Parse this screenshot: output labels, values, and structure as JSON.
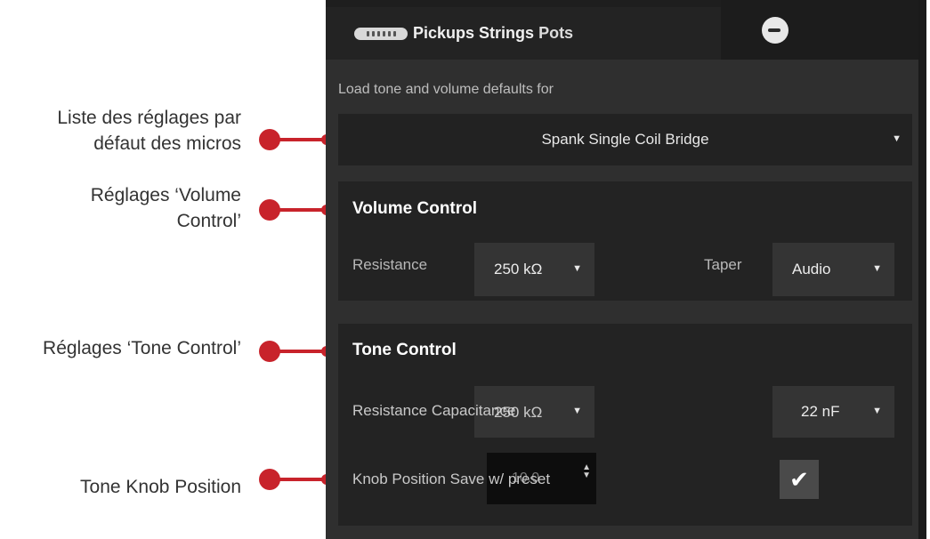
{
  "annotations": {
    "pickup_defaults": "Liste des réglages par défaut des micros",
    "volume": "Réglages ‘Volume Control’",
    "tone": "Réglages ‘Tone Control’",
    "knob": "Tone Knob Position"
  },
  "tabs": {
    "main_label_a": "Pickups Strings",
    "main_label_b": "Pots"
  },
  "defaults": {
    "label": "Load tone and volume defaults for",
    "selected": "Spank Single Coil Bridge"
  },
  "volume_control": {
    "title": "Volume Control",
    "resistance_label": "Resistance",
    "resistance_value": "250 kΩ",
    "taper_label": "Taper",
    "taper_value": "Audio"
  },
  "tone_control": {
    "title": "Tone Control",
    "resistance_label": "Resistance Capacitance",
    "resistance_value": "250 kΩ",
    "capacitance_value": "22 nF",
    "knob_label": "Knob Position Save w/ preset",
    "knob_value": "10.0",
    "save_with_preset_checked": true
  },
  "colors": {
    "annotation_red": "#c8232b",
    "panel_bg": "#2f2f2f"
  },
  "icons": {
    "pickup_tab": "pickup-strip-icon",
    "second_tab": "knob-icon",
    "dropdown": "triangle-down-icon",
    "check": "checkmark-icon"
  }
}
